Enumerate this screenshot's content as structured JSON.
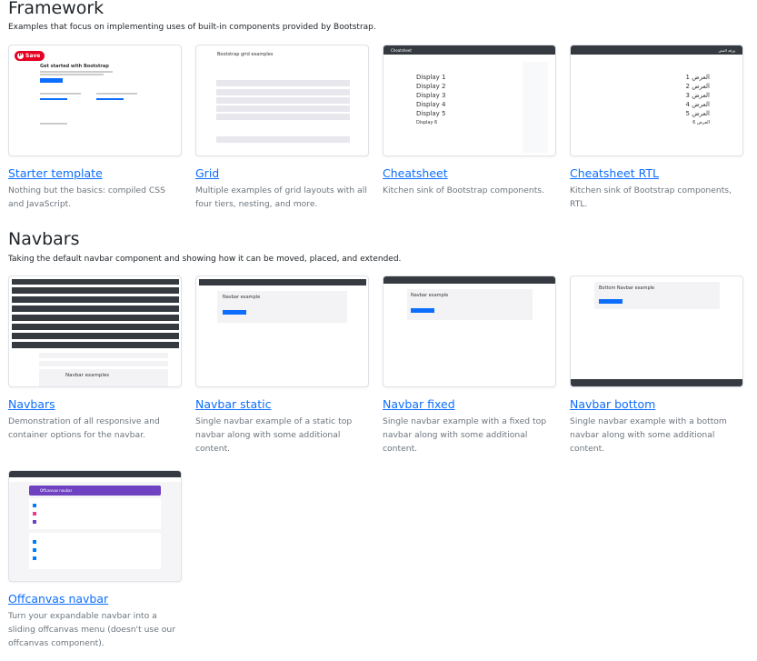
{
  "sections": [
    {
      "title": "Framework",
      "description": "Examples that focus on implementing uses of built-in components provided by Bootstrap.",
      "cards": [
        {
          "title": "Starter template",
          "description": "Nothing but the basics: compiled CSS and JavaScript.",
          "thumb_heading": "Get started with Bootstrap"
        },
        {
          "title": "Grid",
          "description": "Multiple examples of grid layouts with all four tiers, nesting, and more.",
          "thumb_heading": "Bootstrap grid examples"
        },
        {
          "title": "Cheatsheet",
          "description": "Kitchen sink of Bootstrap components.",
          "thumb_heading": "Cheatsheet"
        },
        {
          "title": "Cheatsheet RTL",
          "description": "Kitchen sink of Bootstrap components, RTL.",
          "thumb_heading": "ورقة الغش"
        }
      ]
    },
    {
      "title": "Navbars",
      "description": "Taking the default navbar component and showing how it can be moved, placed, and extended.",
      "cards": [
        {
          "title": "Navbars",
          "description": "Demonstration of all responsive and container options for the navbar.",
          "thumb_heading": "Navbar examples"
        },
        {
          "title": "Navbar static",
          "description": "Single navbar example of a static top navbar along with some additional content.",
          "thumb_heading": "Navbar example"
        },
        {
          "title": "Navbar fixed",
          "description": "Single navbar example with a fixed top navbar along with some additional content.",
          "thumb_heading": "Navbar example"
        },
        {
          "title": "Navbar bottom",
          "description": "Single navbar example with a bottom navbar along with some additional content.",
          "thumb_heading": "Bottom Navbar example"
        },
        {
          "title": "Offcanvas navbar",
          "description": "Turn your expandable navbar into a sliding offcanvas menu (doesn't use our offcanvas component).",
          "thumb_heading": "Offcanvas navbar"
        }
      ]
    }
  ],
  "pinterest_save": "Save",
  "cheatsheet_displays": [
    "Display 1",
    "Display 2",
    "Display 3",
    "Display 4",
    "Display 5",
    "Display 6"
  ],
  "rtl_displays": [
    "العرض 1",
    "العرض 2",
    "العرض 3",
    "العرض 4",
    "العرض 5",
    "العرض 6"
  ],
  "colors": {
    "link": "#0d6efd",
    "navbar": "#343a40",
    "pinterest": "#e60023",
    "offcanvas_purple": "#6f42c1"
  }
}
